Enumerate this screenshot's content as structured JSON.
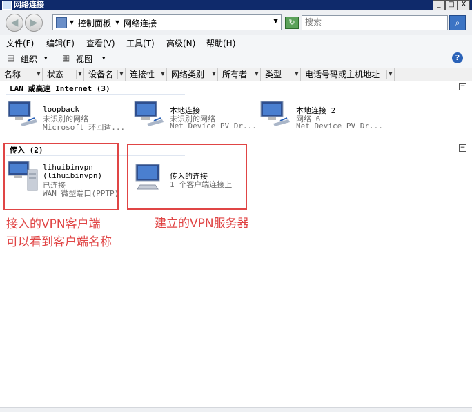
{
  "window": {
    "title": "网络连接",
    "buttons": [
      "_",
      "□",
      "X"
    ]
  },
  "nav": {
    "back_icon": "back-arrow-icon",
    "forward_icon": "forward-arrow-icon",
    "address": {
      "sep": "▾",
      "crumb1": "控制面板",
      "crumb2": "网络连接"
    },
    "search_placeholder": "搜索"
  },
  "menu": [
    "文件(F)",
    "编辑(E)",
    "查看(V)",
    "工具(T)",
    "高级(N)",
    "帮助(H)"
  ],
  "toolbar": {
    "organize": "组织",
    "views": "视图",
    "dropdown": "▾"
  },
  "columns": [
    "名称",
    "状态",
    "设备名",
    "连接性",
    "网络类别",
    "所有者",
    "类型",
    "电话号码或主机地址"
  ],
  "groups": {
    "lan": {
      "label": "LAN 或高速 Internet (3)",
      "collapse": "−",
      "items": [
        {
          "name": "loopback",
          "status": "未识别的网络",
          "device": "Microsoft 环回适..."
        },
        {
          "name": "本地连接",
          "status": "未识别的网络",
          "device": "Net Device PV Dr..."
        },
        {
          "name": "本地连接 2",
          "status": "网络  6",
          "device": "Net Device PV Dr..."
        }
      ]
    },
    "incoming": {
      "label": "传入 (2)",
      "collapse": "−",
      "items": [
        {
          "name": "lihuibinvpn",
          "name2": "(lihuibinvpn)",
          "status": "已连接",
          "device": "WAN 微型端口(PPTP)"
        },
        {
          "name": "传入的连接",
          "status": "1 个客户端连接上"
        }
      ]
    }
  },
  "annotations": {
    "left_line1": "接入的VPN客户端",
    "left_line2": "可以看到客户端名称",
    "right": "建立的VPN服务器",
    "color": "#e04545"
  }
}
